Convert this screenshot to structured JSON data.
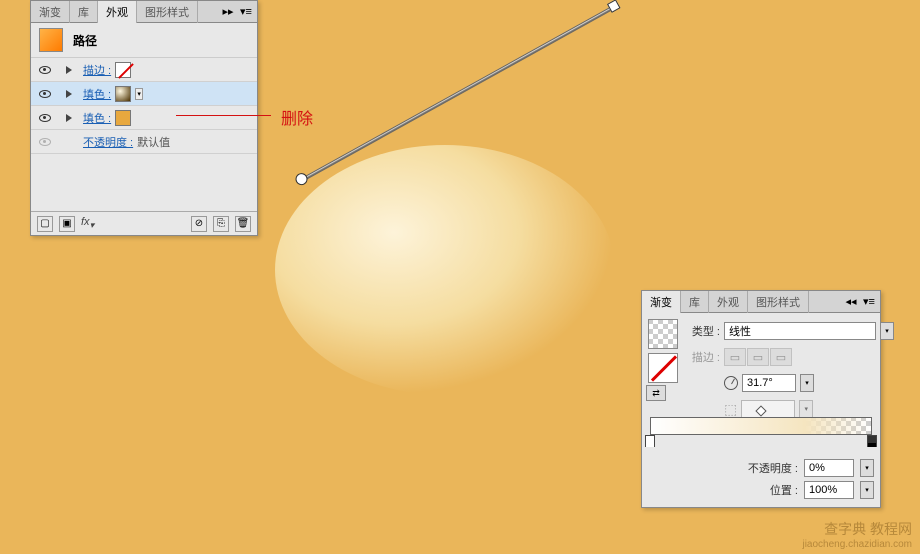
{
  "appearance": {
    "tabs": [
      "渐变",
      "库",
      "外观",
      "图形样式"
    ],
    "active_tab": "外观",
    "object_title": "路径",
    "rows": {
      "stroke": {
        "label": "描边 :"
      },
      "fill1": {
        "label": "填色 :"
      },
      "fill2": {
        "label": "填色 :"
      },
      "opacity": {
        "label": "不透明度 :",
        "value": "默认值"
      }
    }
  },
  "annotation": {
    "text": "删除"
  },
  "gradient": {
    "tabs": [
      "渐变",
      "库",
      "外观",
      "图形样式"
    ],
    "active_tab": "渐变",
    "type_label": "类型 :",
    "type_value": "线性",
    "stroke_label": "描边 :",
    "angle_value": "31.7°",
    "opacity_label": "不透明度 :",
    "opacity_value": "0%",
    "position_label": "位置 :",
    "position_value": "100%"
  },
  "watermark": {
    "main": "查字典 教程网",
    "sub": "jiaocheng.chazidian.com"
  }
}
